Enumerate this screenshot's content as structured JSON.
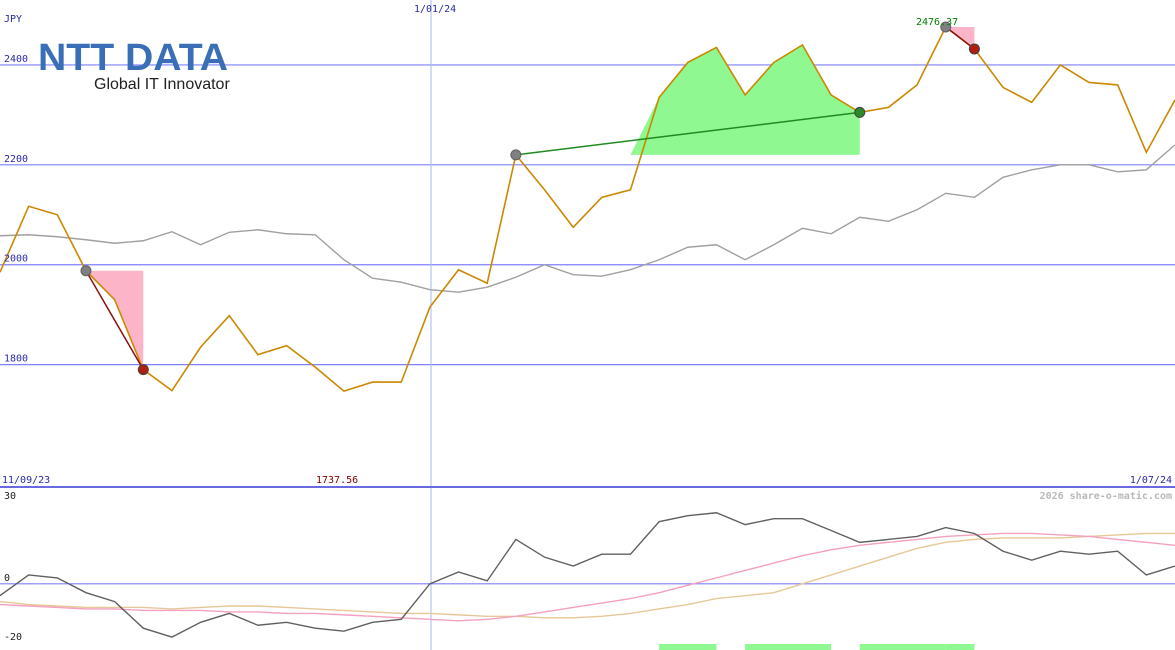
{
  "logo": {
    "name": "NTT DATA",
    "tagline": "Global IT Innovator",
    "color": "#3a6fb7"
  },
  "watermark": "2026 share-o-matic.com",
  "colors": {
    "price": "#cc8800",
    "average": "#a0a0a0",
    "grid": "#7f7fff",
    "up_fill": "#90f890",
    "down_fill": "#fbb4c8",
    "label": "#2a2aaa",
    "max_label": "#008000",
    "min_label": "#800000",
    "osc_main": "#606060",
    "osc_pink": "#f4a0c0",
    "osc_tan": "#e6c898"
  },
  "chart_data": [
    {
      "type": "line",
      "name": "price",
      "currency": "JPY",
      "date_labels": {
        "start": "11/09/23",
        "mid": "1/01/24",
        "end": "1/07/24"
      },
      "yticks": [
        1800,
        2000,
        2200,
        2400
      ],
      "ylim": [
        1555,
        2530
      ],
      "max_label": "2476.37",
      "min_label": "1737.56",
      "series": [
        {
          "name": "price",
          "values": [
            1985,
            2117,
            2100,
            1988,
            1930,
            1790,
            1748,
            1835,
            1898,
            1820,
            1838,
            1795,
            1747,
            1765,
            1765,
            1915,
            1990,
            1963,
            2220,
            2150,
            2075,
            2135,
            2150,
            2335,
            2405,
            2435,
            2340,
            2405,
            2440,
            2340,
            2305,
            2315,
            2360,
            2476,
            2432,
            2355,
            2325,
            2400,
            2365,
            2360,
            2225,
            2330
          ]
        },
        {
          "name": "average",
          "values": [
            2058,
            2060,
            2056,
            2050,
            2043,
            2048,
            2066,
            2040,
            2065,
            2070,
            2062,
            2060,
            2010,
            1973,
            1965,
            1950,
            1945,
            1955,
            1975,
            2000,
            1980,
            1977,
            1990,
            2010,
            2035,
            2040,
            2010,
            2040,
            2073,
            2062,
            2095,
            2087,
            2110,
            2143,
            2135,
            2175,
            2190,
            2200,
            2200,
            2186,
            2190,
            2240
          ]
        }
      ],
      "trades": [
        {
          "from": 3,
          "to": 5,
          "result": "loss",
          "start_value": 1988,
          "end_value": 1790
        },
        {
          "from": 18,
          "to": 30,
          "result": "gain",
          "start_value": 2220,
          "end_value": 2305
        },
        {
          "from": 33,
          "to": 34,
          "result": "loss",
          "start_value": 2476,
          "end_value": 2432
        }
      ]
    },
    {
      "type": "line",
      "name": "oscillator",
      "yticks": [
        30,
        0,
        -20
      ],
      "ylim": [
        -20,
        30
      ],
      "series": [
        {
          "name": "oscillator",
          "values": [
            -4,
            3,
            2,
            -3,
            -6,
            -15,
            -18,
            -13,
            -10,
            -14,
            -13,
            -15,
            -16,
            -13,
            -12,
            0,
            4,
            1,
            15,
            9,
            6,
            10,
            10,
            21,
            23,
            24,
            20,
            22,
            22,
            18,
            14,
            15,
            16,
            19,
            17,
            11,
            8,
            11,
            10,
            11,
            3,
            6
          ]
        },
        {
          "name": "pink",
          "values": [
            -7,
            -7.5,
            -8,
            -8.5,
            -8.5,
            -9,
            -9,
            -9,
            -9.5,
            -9.5,
            -10,
            -10,
            -10.5,
            -11,
            -11.5,
            -12,
            -12.5,
            -12,
            -11,
            -9.5,
            -8,
            -6.5,
            -5,
            -3,
            -0.5,
            2,
            4.5,
            7,
            9.5,
            11.5,
            13,
            14,
            15,
            16,
            16.5,
            17,
            17,
            16.5,
            16,
            15,
            14,
            13
          ]
        },
        {
          "name": "tan",
          "values": [
            -6,
            -7,
            -7.5,
            -8,
            -8,
            -8,
            -8.5,
            -8,
            -7.5,
            -7.5,
            -8,
            -8.5,
            -9,
            -9.5,
            -10,
            -10,
            -10.5,
            -11,
            -11,
            -11.5,
            -11.5,
            -11,
            -10,
            -8.5,
            -7,
            -5,
            -4,
            -3,
            0,
            3,
            6,
            9,
            12,
            14,
            15,
            15.5,
            15.5,
            15.5,
            16,
            16.5,
            17,
            17
          ]
        }
      ],
      "volume_bars": [
        {
          "from": 23,
          "to": 25,
          "level": 1
        },
        {
          "from": 26,
          "to": 29,
          "level": 1
        },
        {
          "from": 30,
          "to": 33,
          "level": 1
        },
        {
          "from": 33,
          "to": 34,
          "level": 1
        }
      ]
    }
  ]
}
